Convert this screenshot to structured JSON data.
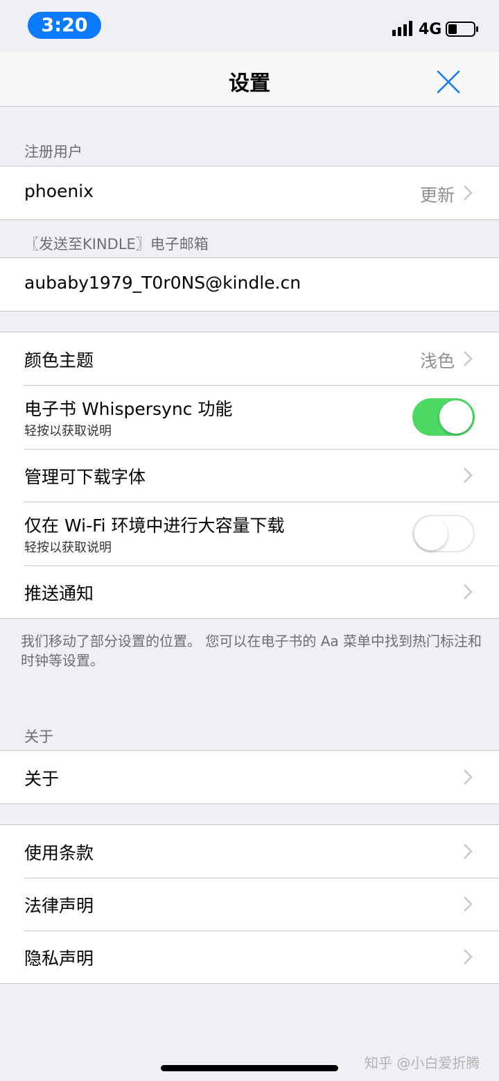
{
  "status": {
    "time": "3:20",
    "network": "4G"
  },
  "nav": {
    "title": "设置"
  },
  "sections": {
    "registered_user": {
      "header": "注册用户",
      "username": "phoenix",
      "update_label": "更新"
    },
    "kindle_email": {
      "header": "〖发送至KINDLE〗电子邮箱",
      "email": "aubaby1979_T0r0NS@kindle.cn"
    },
    "options": {
      "color_theme": {
        "label": "颜色主题",
        "value": "浅色"
      },
      "whispersync": {
        "label": "电子书 Whispersync 功能",
        "hint": "轻按以获取说明",
        "enabled": true
      },
      "fonts": {
        "label": "管理可下载字体"
      },
      "wifi_download": {
        "label": "仅在 Wi-Fi 环境中进行大容量下载",
        "hint": "轻按以获取说明",
        "enabled": false
      },
      "push": {
        "label": "推送通知"
      },
      "footnote": "我们移动了部分设置的位置。 您可以在电子书的 Aa 菜单中找到热门标注和时钟等设置。"
    },
    "about": {
      "header": "关于",
      "about_label": "关于"
    },
    "legal": {
      "terms": "使用条款",
      "legal": "法律声明",
      "privacy": "隐私声明"
    }
  },
  "watermark": "知乎 @小白爱折腾",
  "colors": {
    "accent": "#0a7aff",
    "toggle_on": "#4cd964",
    "background": "#efeff4"
  }
}
